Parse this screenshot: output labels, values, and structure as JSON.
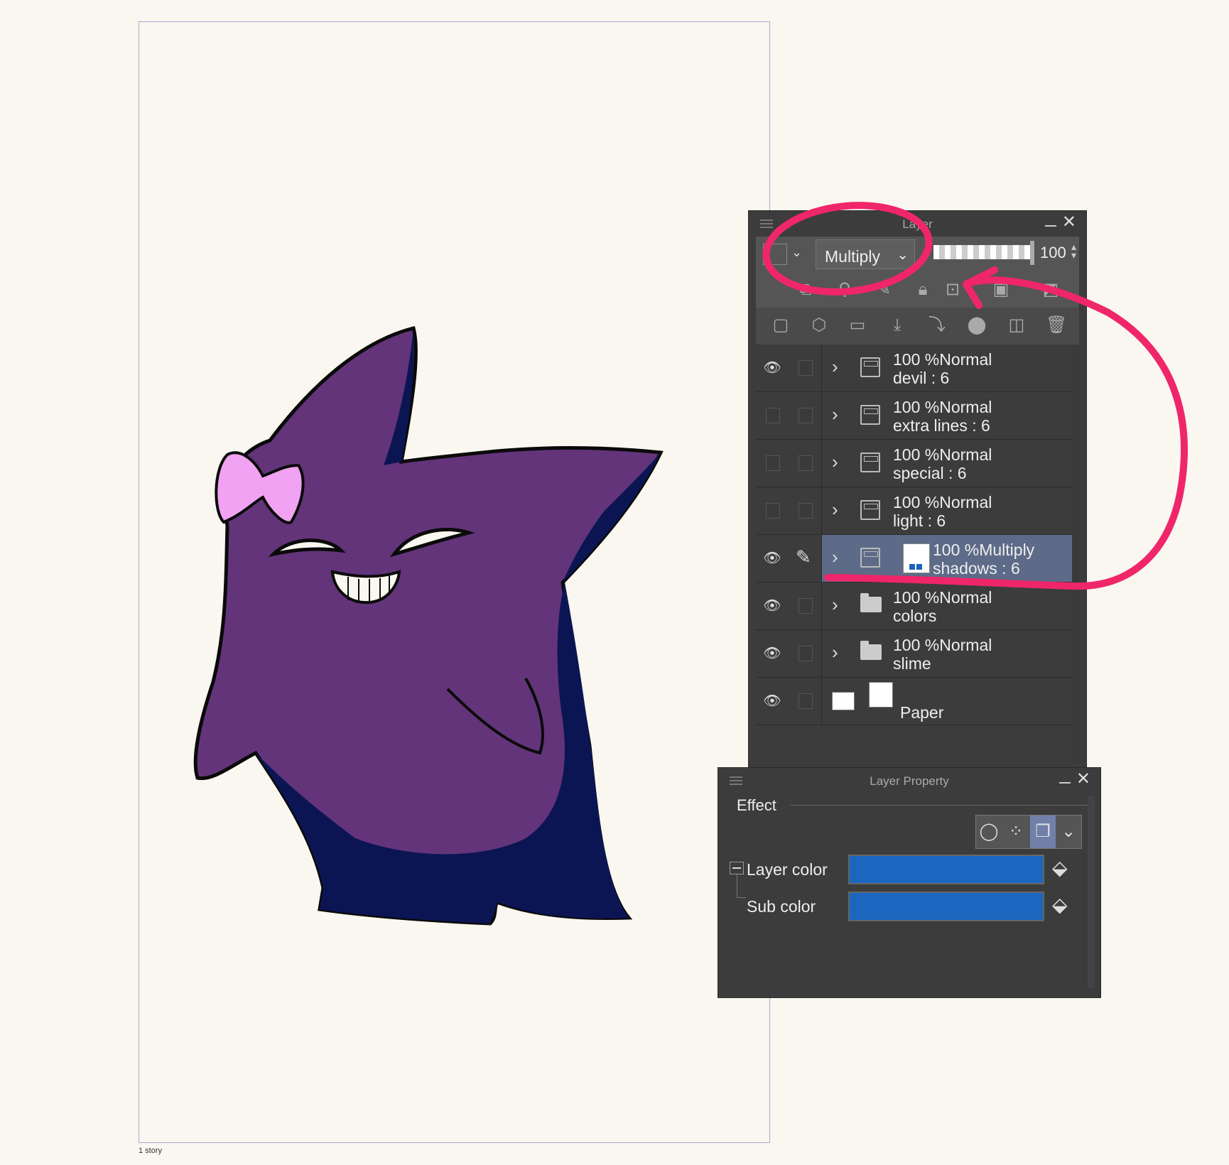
{
  "canvas": {
    "story_label": "1 story"
  },
  "layer_panel": {
    "title": "Layer",
    "blend_mode": "Multiply",
    "opacity": "100",
    "layers": [
      {
        "opacity": "100 %",
        "mode": "Normal",
        "name": "devil : 6",
        "visible": true,
        "type": "layer-group"
      },
      {
        "opacity": "100 %",
        "mode": "Normal",
        "name": "extra lines : 6",
        "visible": false,
        "type": "layer-group"
      },
      {
        "opacity": "100 %",
        "mode": "Normal",
        "name": "special : 6",
        "visible": false,
        "type": "layer-group"
      },
      {
        "opacity": "100 %",
        "mode": "Normal",
        "name": "light : 6",
        "visible": false,
        "type": "layer-group"
      },
      {
        "opacity": "100 %",
        "mode": "Multiply",
        "name": "shadows : 6",
        "visible": true,
        "selected": true,
        "type": "layer-group"
      },
      {
        "opacity": "100 %",
        "mode": "Normal",
        "name": "colors",
        "visible": true,
        "type": "folder"
      },
      {
        "opacity": "100 %",
        "mode": "Normal",
        "name": "slime",
        "visible": true,
        "type": "folder"
      },
      {
        "name": "Paper",
        "visible": true,
        "type": "paper"
      }
    ]
  },
  "layer_property": {
    "title": "Layer Property",
    "section": "Effect",
    "layer_color_label": "Layer color",
    "sub_color_label": "Sub color",
    "layer_color": "#1b66bf",
    "sub_color": "#1b66bf"
  },
  "colors": {
    "accent_annotation": "#f0266a",
    "body_purple": "#63347a",
    "shadow_navy": "#0c1554",
    "bow_pink": "#f2a2f2"
  }
}
